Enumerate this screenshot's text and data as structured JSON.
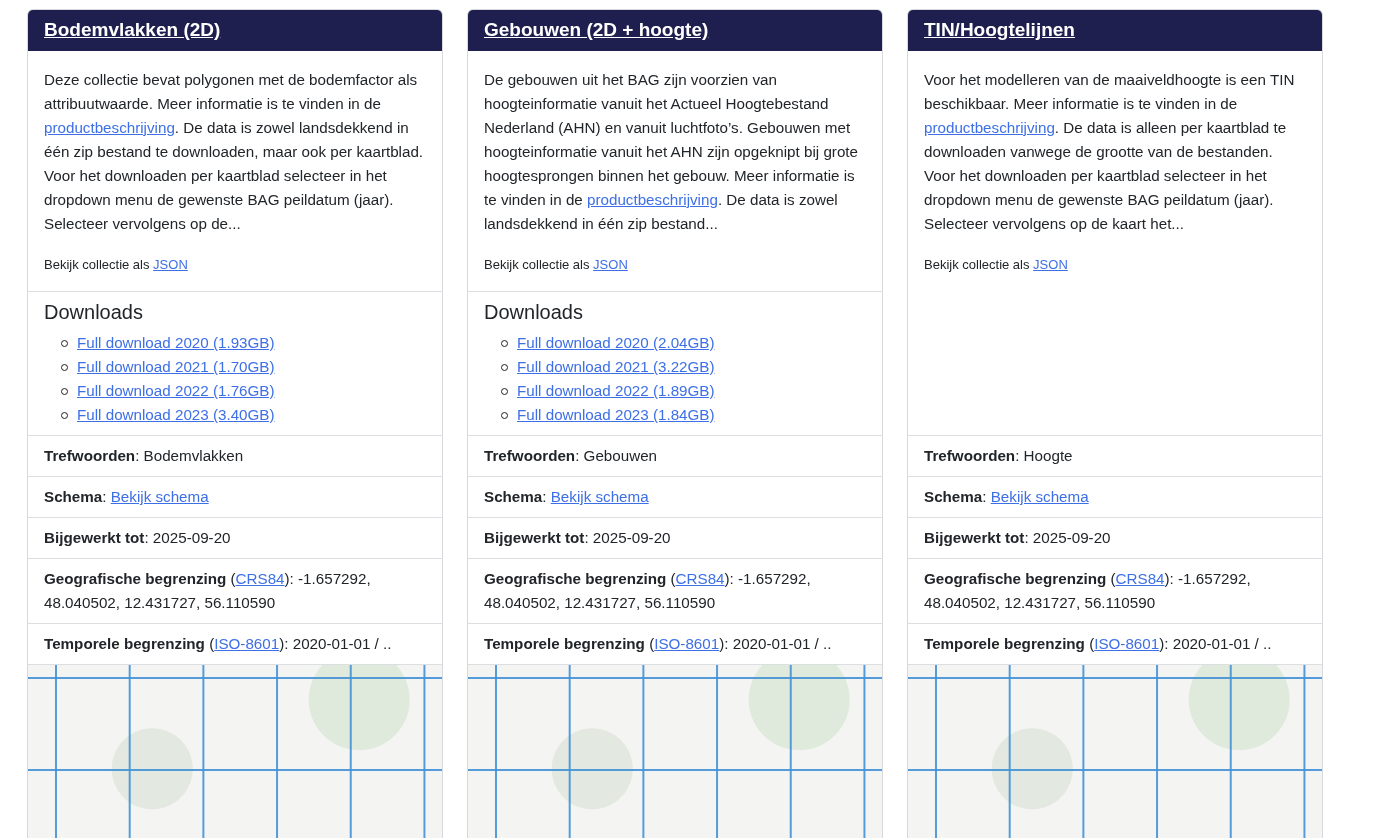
{
  "collections": [
    {
      "title": "Bodemvlakken (2D)",
      "description": [
        {
          "text": "Deze collectie bevat polygonen met de bodemfactor als attribuutwaarde. Meer informatie is te vinden in de "
        },
        {
          "link": "productbeschrijving"
        },
        {
          "text": ". De data is zowel landsdekkend in één zip bestand te downloaden, maar ook per kaartblad. Voor het downloaden per kaartblad selecteer in het dropdown menu de gewenste BAG peildatum (jaar). Selecteer vervolgens op de..."
        }
      ],
      "json_note": [
        {
          "text": "Bekijk collectie als "
        },
        {
          "link": "JSON"
        }
      ],
      "downloads": {
        "heading": "Downloads",
        "items": [
          "Full download 2020 (1.93GB)",
          "Full download 2021 (1.70GB)",
          "Full download 2022 (1.76GB)",
          "Full download 2023 (3.40GB)"
        ]
      },
      "properties": [
        [
          {
            "text": "**Trefwoorden**: Bodemvlakken"
          }
        ],
        [
          {
            "text": "**Schema**: "
          },
          {
            "link": "Bekijk schema"
          }
        ],
        [
          {
            "text": "**Bijgewerkt tot**: 2025-09-20"
          }
        ],
        [
          {
            "text": "**Geografische begrenzing** ("
          },
          {
            "link": "CRS84"
          },
          {
            "text": "): -1.657292, 48.040502, 12.431727, 56.110590"
          }
        ],
        [
          {
            "text": "**Temporele begrenzing** ("
          },
          {
            "link": "ISO-8601"
          },
          {
            "text": "): 2020-01-01 / .."
          }
        ]
      ]
    },
    {
      "title": "Gebouwen (2D + hoogte)",
      "description": [
        {
          "text": "De gebouwen uit het BAG zijn voorzien van hoogteinformatie vanuit het Actueel Hoogtebestand Nederland (AHN) en vanuit luchtfoto’s. Gebouwen met hoogteinformatie vanuit het AHN zijn opgeknipt bij grote hoogtesprongen binnen het gebouw. Meer informatie is te vinden in de "
        },
        {
          "link": "productbeschrijving"
        },
        {
          "text": ". De data is zowel landsdekkend in één zip bestand..."
        }
      ],
      "json_note": [
        {
          "text": "Bekijk collectie als "
        },
        {
          "link": "JSON"
        }
      ],
      "downloads": {
        "heading": "Downloads",
        "items": [
          "Full download 2020 (2.04GB)",
          "Full download 2021 (3.22GB)",
          "Full download 2022 (1.89GB)",
          "Full download 2023 (1.84GB)"
        ]
      },
      "properties": [
        [
          {
            "text": "**Trefwoorden**: Gebouwen"
          }
        ],
        [
          {
            "text": "**Schema**: "
          },
          {
            "link": "Bekijk schema"
          }
        ],
        [
          {
            "text": "**Bijgewerkt tot**: 2025-09-20"
          }
        ],
        [
          {
            "text": "**Geografische begrenzing** ("
          },
          {
            "link": "CRS84"
          },
          {
            "text": "): -1.657292, 48.040502, 12.431727, 56.110590"
          }
        ],
        [
          {
            "text": "**Temporele begrenzing** ("
          },
          {
            "link": "ISO-8601"
          },
          {
            "text": "): 2020-01-01 / .."
          }
        ]
      ]
    },
    {
      "title": "TIN/Hoogtelijnen",
      "description": [
        {
          "text": "Voor het modelleren van de maaiveldhoogte is een TIN beschikbaar. Meer informatie is te vinden in de "
        },
        {
          "link": "productbeschrijving"
        },
        {
          "text": ". De data is alleen per kaartblad te downloaden vanwege de grootte van de bestanden. Voor het downloaden per kaartblad selecteer in het dropdown menu de gewenste BAG peildatum (jaar). Selecteer vervolgens op de kaart het..."
        }
      ],
      "json_note": [
        {
          "text": "Bekijk collectie als "
        },
        {
          "link": "JSON"
        }
      ],
      "properties": [
        [
          {
            "text": "**Trefwoorden**: Hoogte"
          }
        ],
        [
          {
            "text": "**Schema**: "
          },
          {
            "link": "Bekijk schema"
          }
        ],
        [
          {
            "text": "**Bijgewerkt tot**: 2025-09-20"
          }
        ],
        [
          {
            "text": "**Geografische begrenzing** ("
          },
          {
            "link": "CRS84"
          },
          {
            "text": "): -1.657292, 48.040502, 12.431727, 56.110590"
          }
        ],
        [
          {
            "text": "**Temporele begrenzing** ("
          },
          {
            "link": "ISO-8601"
          },
          {
            "text": "): 2020-01-01 / .."
          }
        ]
      ]
    }
  ]
}
